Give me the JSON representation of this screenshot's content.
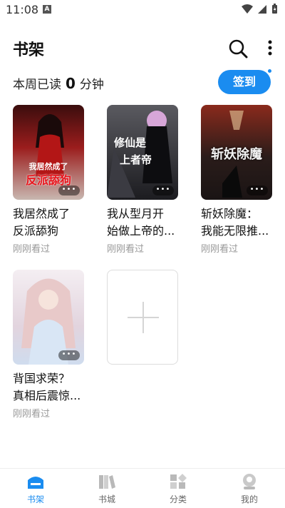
{
  "status": {
    "time": "11:08",
    "notif_icon": "a-letter-icon"
  },
  "header": {
    "title": "书架",
    "search_icon": "search-icon",
    "more_icon": "more-vertical-icon"
  },
  "reading": {
    "prefix": "本周已读",
    "minutes": "0",
    "suffix": "分钟"
  },
  "signin": {
    "label": "签到"
  },
  "books": [
    {
      "title_line1": "我居然成了",
      "title_line2": "反派舔狗",
      "status": "刚刚看过",
      "cover_line1": "我居然成了",
      "cover_line2": "反派舔狗",
      "cover_color": "#8a1a1a"
    },
    {
      "title_line1": "我从型月开",
      "title_line2": "始做上帝的...",
      "status": "刚刚看过",
      "cover_line1": "修仙是",
      "cover_line2": "上者帝",
      "cover_color": "#2b2b30"
    },
    {
      "title_line1": "斩妖除魔：",
      "title_line2": "我能无限推...",
      "status": "刚刚看过",
      "cover_line1": "斩妖除魔",
      "cover_line2": "",
      "cover_color": "#3a2a26"
    },
    {
      "title_line1": "背国求荣？",
      "title_line2": "真相后震惊...",
      "status": "刚刚看过",
      "cover_line1": "",
      "cover_line2": "",
      "cover_color": "#e8dfe6"
    }
  ],
  "tabs": [
    {
      "label": "书架",
      "icon": "bookshelf-icon",
      "active": true
    },
    {
      "label": "书城",
      "icon": "bookstore-icon",
      "active": false
    },
    {
      "label": "分类",
      "icon": "category-icon",
      "active": false
    },
    {
      "label": "我的",
      "icon": "profile-icon",
      "active": false
    }
  ],
  "colors": {
    "accent": "#1a8cf0",
    "muted": "#999999"
  }
}
